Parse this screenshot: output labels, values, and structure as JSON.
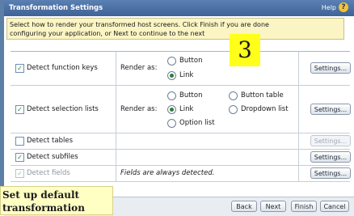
{
  "header": {
    "title": "Transformation Settings",
    "help": "Help"
  },
  "instructions": {
    "line1": "Select how to render your transformed host screens. Click Finish if you are done",
    "line2": "configuring your application, or Next to continue to the next"
  },
  "callouts": {
    "step_number": "3",
    "setup_line1": "Set up default",
    "setup_line2": "transformation"
  },
  "rows": {
    "function_keys": {
      "label": "Detect function keys",
      "checked": true,
      "render_as": "Render as:",
      "options": [
        "Button",
        "Link"
      ],
      "selected": "Link",
      "settings": "Settings..."
    },
    "selection_lists": {
      "label": "Detect selection lists",
      "checked": true,
      "render_as": "Render as:",
      "options": [
        "Button",
        "Button table",
        "Link",
        "Dropdown list",
        "Option list"
      ],
      "selected": "Link",
      "settings": "Settings..."
    },
    "tables": {
      "label": "Detect tables",
      "checked": false,
      "settings": "Settings..."
    },
    "subfiles": {
      "label": "Detect subfiles",
      "checked": true,
      "settings": "Settings..."
    },
    "fields": {
      "label": "Detect fields",
      "checked": true,
      "note": "Fields are always detected.",
      "settings": "Settings..."
    }
  },
  "footer": {
    "back": "Back",
    "next": "Next",
    "finish": "Finish",
    "cancel": "Cancel"
  },
  "colors": {
    "header": "#4a6fa3",
    "instructions_bg": "#fbf5c4",
    "callout_yellow": "#ffff1a",
    "setup_bg": "#ffffc4",
    "checked": "#2e7d32"
  }
}
